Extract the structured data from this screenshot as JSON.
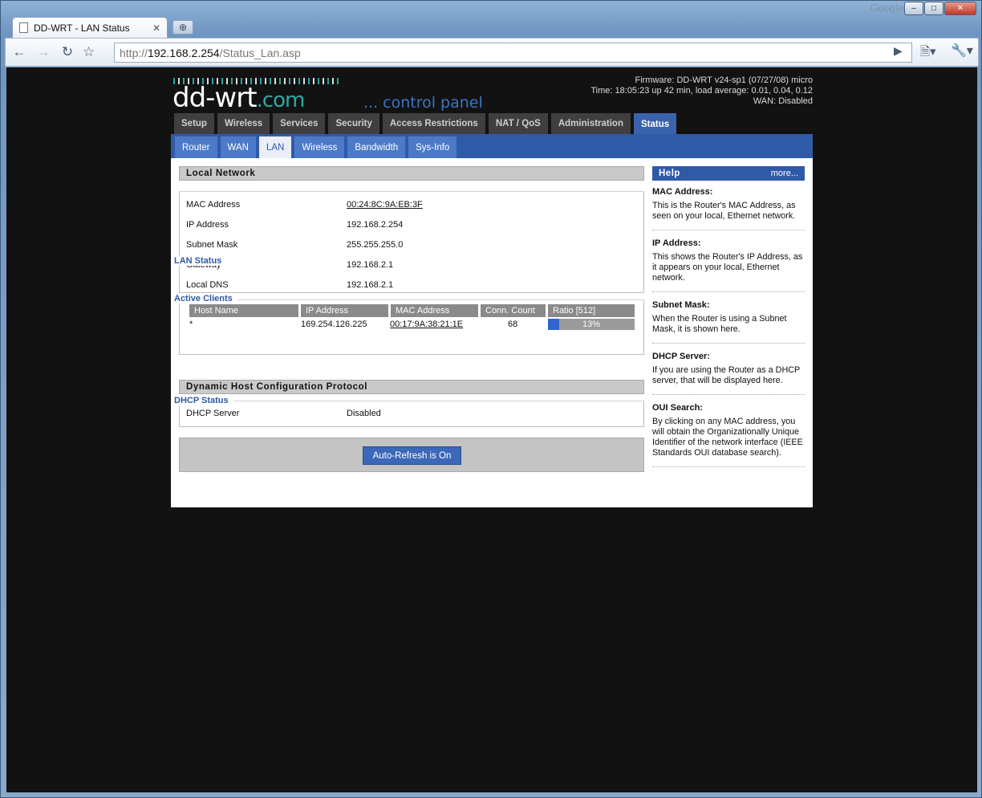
{
  "browser": {
    "tab_title": "DD-WRT - LAN Status",
    "google_label": "Google",
    "url_scheme": "http://",
    "url_host": "192.168.2.254",
    "url_path": "/Status_Lan.asp"
  },
  "header": {
    "logo": "dd-wrt",
    "logo_com": ".com",
    "subtitle": "... control panel",
    "firmware": "Firmware: DD-WRT v24-sp1 (07/27/08) micro",
    "time": "Time: 18:05:23 up 42 min, load average: 0.01, 0.04, 0.12",
    "wan": "WAN: Disabled"
  },
  "main_tabs": [
    "Setup",
    "Wireless",
    "Services",
    "Security",
    "Access Restrictions",
    "NAT / QoS",
    "Administration",
    "Status"
  ],
  "sub_tabs": [
    "Router",
    "WAN",
    "LAN",
    "Wireless",
    "Bandwidth",
    "Sys-Info"
  ],
  "local_network": {
    "title": "Local Network",
    "lan_status_legend": "LAN Status",
    "rows": [
      {
        "label": "MAC Address",
        "value": "00:24:8C:9A:EB:3F"
      },
      {
        "label": "IP Address",
        "value": "192.168.2.254"
      },
      {
        "label": "Subnet Mask",
        "value": "255.255.255.0"
      },
      {
        "label": "Gateway",
        "value": "192.168.2.1"
      },
      {
        "label": "Local DNS",
        "value": "192.168.2.1"
      }
    ]
  },
  "active_clients": {
    "legend": "Active Clients",
    "headers": [
      "Host Name",
      "IP Address",
      "MAC Address",
      "Conn. Count",
      "Ratio [512]"
    ],
    "rows": [
      {
        "host": "*",
        "ip": "169.254.126.225",
        "mac": "00:17:9A:38:21:1E",
        "count": "68",
        "ratio": "13%",
        "ratio_fraction": 0.13
      }
    ]
  },
  "dhcp": {
    "title": "Dynamic Host Configuration Protocol",
    "legend": "DHCP Status",
    "label": "DHCP Server",
    "value": "Disabled"
  },
  "refresh_button": "Auto-Refresh is On",
  "help": {
    "title": "Help",
    "more": "more...",
    "items": [
      {
        "title": "MAC Address:",
        "body": "This is the Router's MAC Address, as seen on your local, Ethernet network."
      },
      {
        "title": "IP Address:",
        "body": "This shows the Router's IP Address, as it appears on your local, Ethernet network."
      },
      {
        "title": "Subnet Mask:",
        "body": "When the Router is using a Subnet Mask, it is shown here."
      },
      {
        "title": "DHCP Server:",
        "body": "If you are using the Router as a DHCP server, that will be displayed here."
      },
      {
        "title": "OUI Search:",
        "body": "By clicking on any MAC address, you will obtain the Organizationally Unique Identifier of the network interface (IEEE Standards OUI database search)."
      }
    ]
  },
  "colors": {
    "accent": "#2f5aa8",
    "active_tab": "#3a63ad",
    "ratio_fill": "#3366cc"
  }
}
